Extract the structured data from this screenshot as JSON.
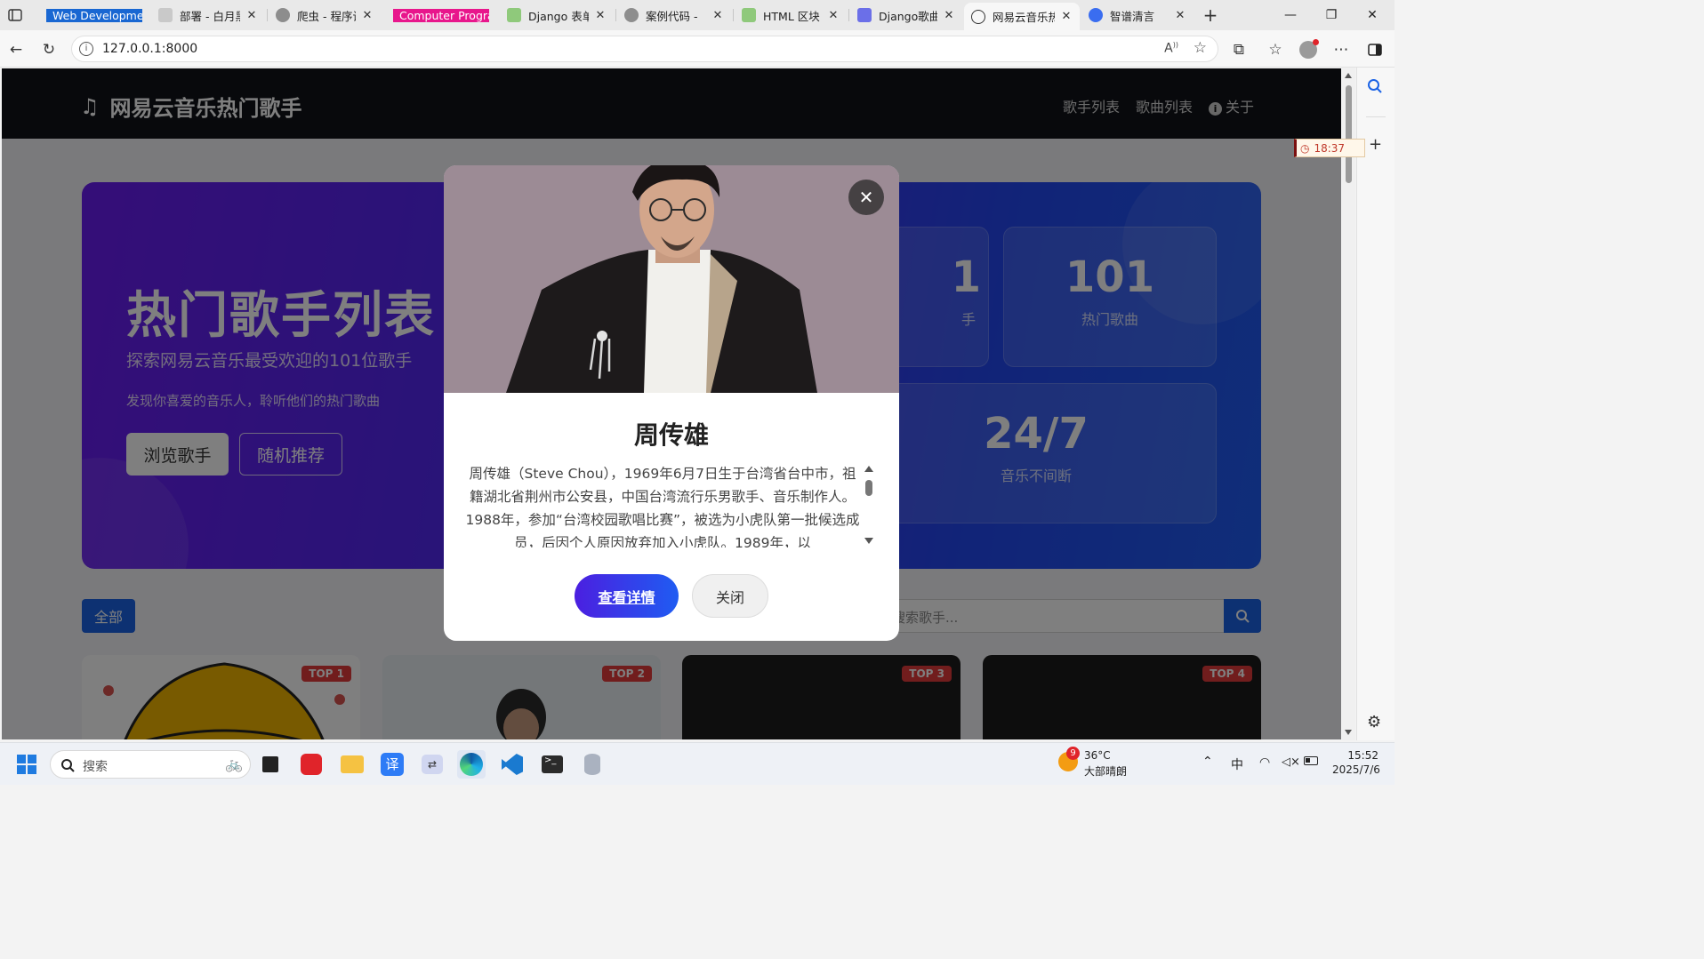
{
  "browser": {
    "tabs": [
      {
        "label": "Web Development",
        "group": "blue"
      },
      {
        "label": "部署 - 白月黑"
      },
      {
        "label": "爬虫 - 程序设"
      },
      {
        "label": "Computer Program",
        "group": "pink"
      },
      {
        "label": "Django 表单"
      },
      {
        "label": "案例代码 -"
      },
      {
        "label": "HTML 区块"
      },
      {
        "label": "Django歌曲"
      },
      {
        "label": "网易云音乐热",
        "active": true
      },
      {
        "label": "智谱清言"
      }
    ],
    "url": "127.0.0.1:8000",
    "timer": "18:37"
  },
  "site": {
    "brand": "网易云音乐热门歌手",
    "nav": [
      "歌手列表",
      "歌曲列表",
      "关于"
    ],
    "hero": {
      "title": "热门歌手列表",
      "subtitle": "探索网易云音乐最受欢迎的101位歌手",
      "tagline": "发现你喜爱的音乐人，聆听他们的热门歌曲",
      "browse_btn": "浏览歌手",
      "random_btn": "随机推荐",
      "stats": [
        {
          "num": "1",
          "label": "手"
        },
        {
          "num": "101",
          "label": "热门歌曲"
        },
        {
          "num": "24/7",
          "label": "音乐不间断"
        }
      ]
    },
    "filter_all": "全部",
    "search_placeholder": "搜索歌手...",
    "cards": [
      "TOP 1",
      "TOP 2",
      "TOP 3",
      "TOP 4"
    ]
  },
  "modal": {
    "name": "周传雄",
    "bio": "周传雄（Steve Chou），1969年6月7日生于台湾省台中市，祖籍湖北省荆州市公安县，中国台湾流行乐男歌手、音乐制作人。1988年，参加“台湾校园歌唱比赛”，被选为小虎队第一批候选成员，后因个人原因放弃加入小虎队。1989年，以",
    "detail_btn": "查看详情",
    "close_btn": "关闭"
  },
  "taskbar": {
    "search": "搜索",
    "weather_temp": "36°C",
    "weather_desc": "大部晴朗",
    "weather_badge": "9",
    "ime": "中",
    "time": "15:52",
    "date": "2025/7/6"
  }
}
